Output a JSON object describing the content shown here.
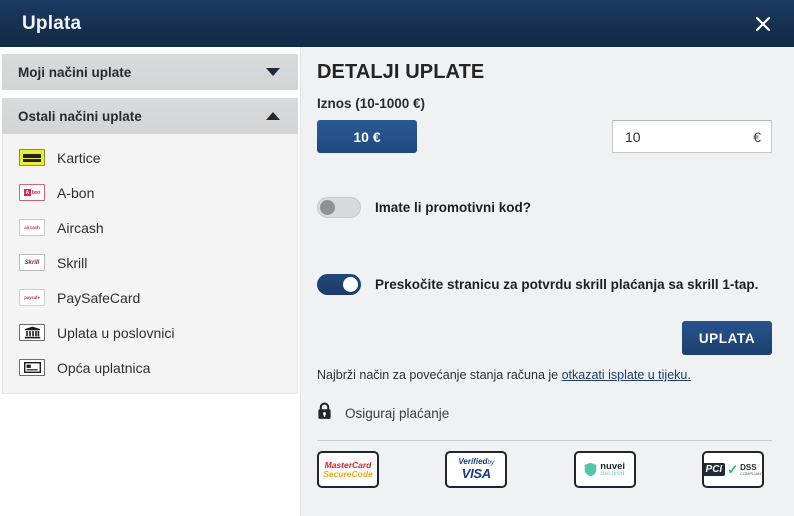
{
  "titlebar": {
    "title": "Uplata",
    "close_icon": "close-icon"
  },
  "sidebar": {
    "sections": [
      {
        "label": "Moji načini uplate",
        "expanded": false,
        "caret_icon": "chevron-down-icon"
      },
      {
        "label": "Ostali načini uplate",
        "expanded": true,
        "caret_icon": "chevron-up-icon"
      }
    ],
    "methods": [
      {
        "label": "Kartice",
        "icon": "credit-card-icon"
      },
      {
        "label": "A-bon",
        "icon": "a-bon-logo-icon"
      },
      {
        "label": "Aircash",
        "icon": "aircash-logo-icon"
      },
      {
        "label": "Skrill",
        "icon": "skrill-logo-icon"
      },
      {
        "label": "PaySafeCard",
        "icon": "paysafecard-logo-icon"
      },
      {
        "label": "Uplata u poslovnici",
        "icon": "shop-icon"
      },
      {
        "label": "Opća uplatnica",
        "icon": "payment-slip-icon"
      }
    ]
  },
  "main": {
    "panel_title": "DETALJI UPLATE",
    "amount_label": "Iznos (10-1000 €)",
    "preset_button": "10 €",
    "amount_value": "10",
    "amount_placeholder": "10",
    "currency": "€",
    "promo_toggle": {
      "label": "Imate li promotivni kod?",
      "state": "off"
    },
    "skip_toggle": {
      "label": "Preskočite stranicu za potvrdu skrill plaćanja sa skrill 1-tap.",
      "state": "on"
    },
    "submit_button": "UPLATA",
    "hint_text": "Najbrži način za povećanje stanja računa je ",
    "hint_link": "otkazati isplate u tijeku.",
    "secure_text": "Osiguraj plaćanje",
    "lock_icon": "lock-icon",
    "badges": [
      {
        "name": "mastercard-securecode-badge",
        "line1_a": "MasterCard",
        "line1_b": "",
        "line2": "SecureCode"
      },
      {
        "name": "verified-by-visa-badge",
        "line1_a": "Verified",
        "line1_b": "by",
        "line2": "VISA"
      },
      {
        "name": "nuvei-secured-badge",
        "line1_a": "nuvei",
        "line1_b": "",
        "line2": "Secured"
      },
      {
        "name": "pci-dss-badge",
        "line1_a": "PCI",
        "line1_b": "DSS",
        "line2": "COMPLIANT"
      }
    ]
  },
  "colors": {
    "titlebar": "#16304f",
    "accent": "#1d3f6e",
    "panel_bg": "#f0f1f2",
    "sidebar_header": "#d5d7d9"
  }
}
